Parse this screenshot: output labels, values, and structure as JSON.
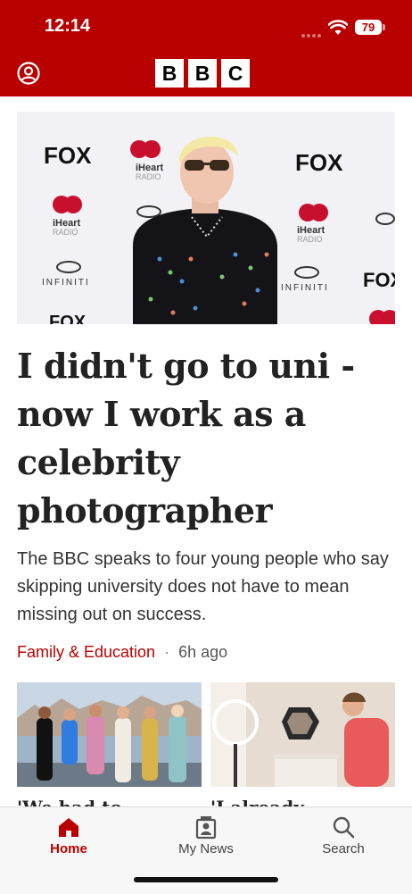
{
  "status": {
    "time": "12:14",
    "battery": "79"
  },
  "header": {
    "logo_letters": [
      "B",
      "B",
      "C"
    ],
    "brand_color": "#b80000"
  },
  "hero_image": {
    "backdrop_text": {
      "fox": "FOX",
      "iheart": "iHeart",
      "radio": "RADIO",
      "infiniti": "INFINITI"
    }
  },
  "article": {
    "headline": "I didn't go to uni - now I work as a celebrity photographer",
    "summary": "The BBC speaks to four young people who say skipping university does not have to mean missing out on success.",
    "category": "Family & Education",
    "separator": "·",
    "time_ago": "6h ago"
  },
  "more_stories": [
    {
      "peek": "'We had to"
    },
    {
      "peek": "'I already"
    }
  ],
  "tabs": [
    {
      "label": "Home",
      "icon": "home-icon",
      "active": true
    },
    {
      "label": "My News",
      "icon": "my-news-icon",
      "active": false
    },
    {
      "label": "Search",
      "icon": "search-icon",
      "active": false
    }
  ]
}
